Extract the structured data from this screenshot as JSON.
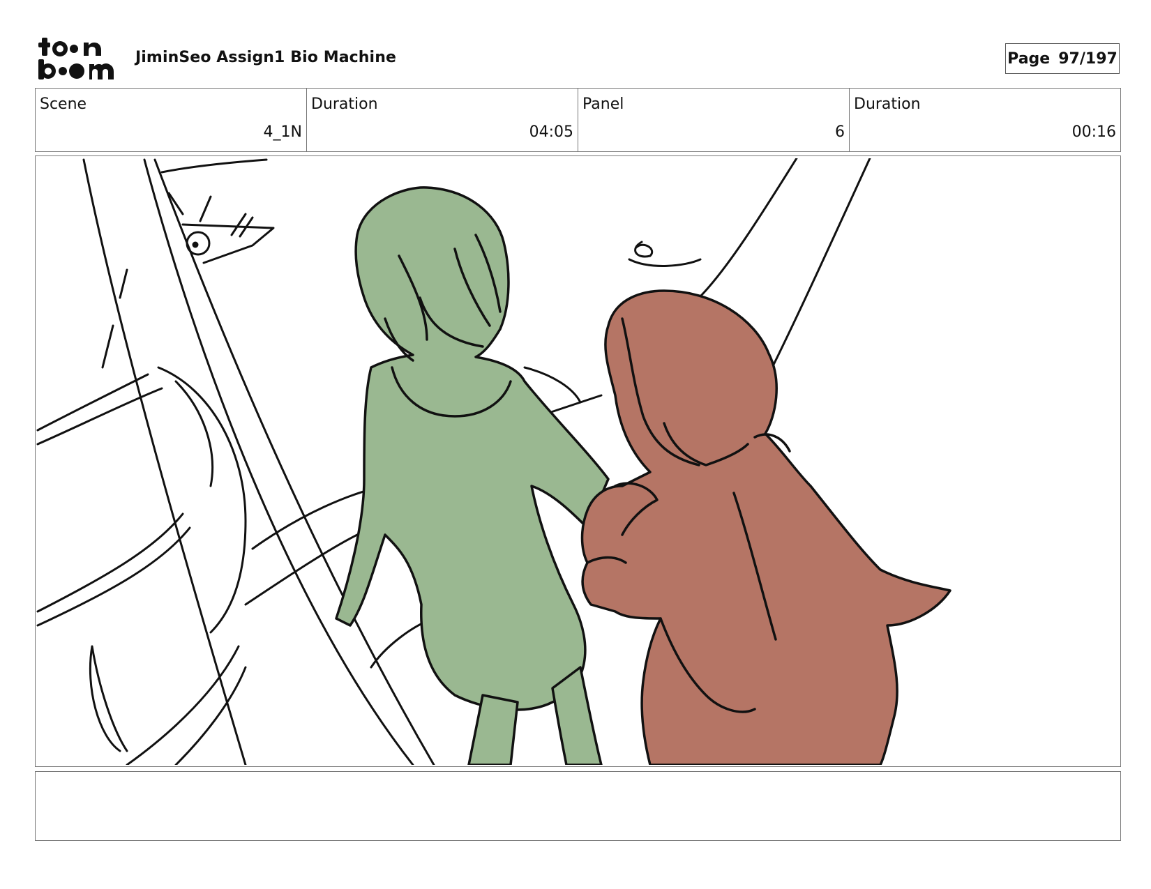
{
  "header": {
    "project_title": "JiminSeo Assign1 Bio Machine",
    "page_label": "Page",
    "page_value": "97/197"
  },
  "info": {
    "scene_label": "Scene",
    "scene_value": "4_1N",
    "scene_duration_label": "Duration",
    "scene_duration_value": "04:05",
    "panel_label": "Panel",
    "panel_value": "6",
    "panel_duration_label": "Duration",
    "panel_duration_value": "00:16"
  },
  "notes": {
    "text": ""
  },
  "colors": {
    "green_fill": "#9ab891",
    "red_fill": "#b57565",
    "ink": "#111111"
  }
}
